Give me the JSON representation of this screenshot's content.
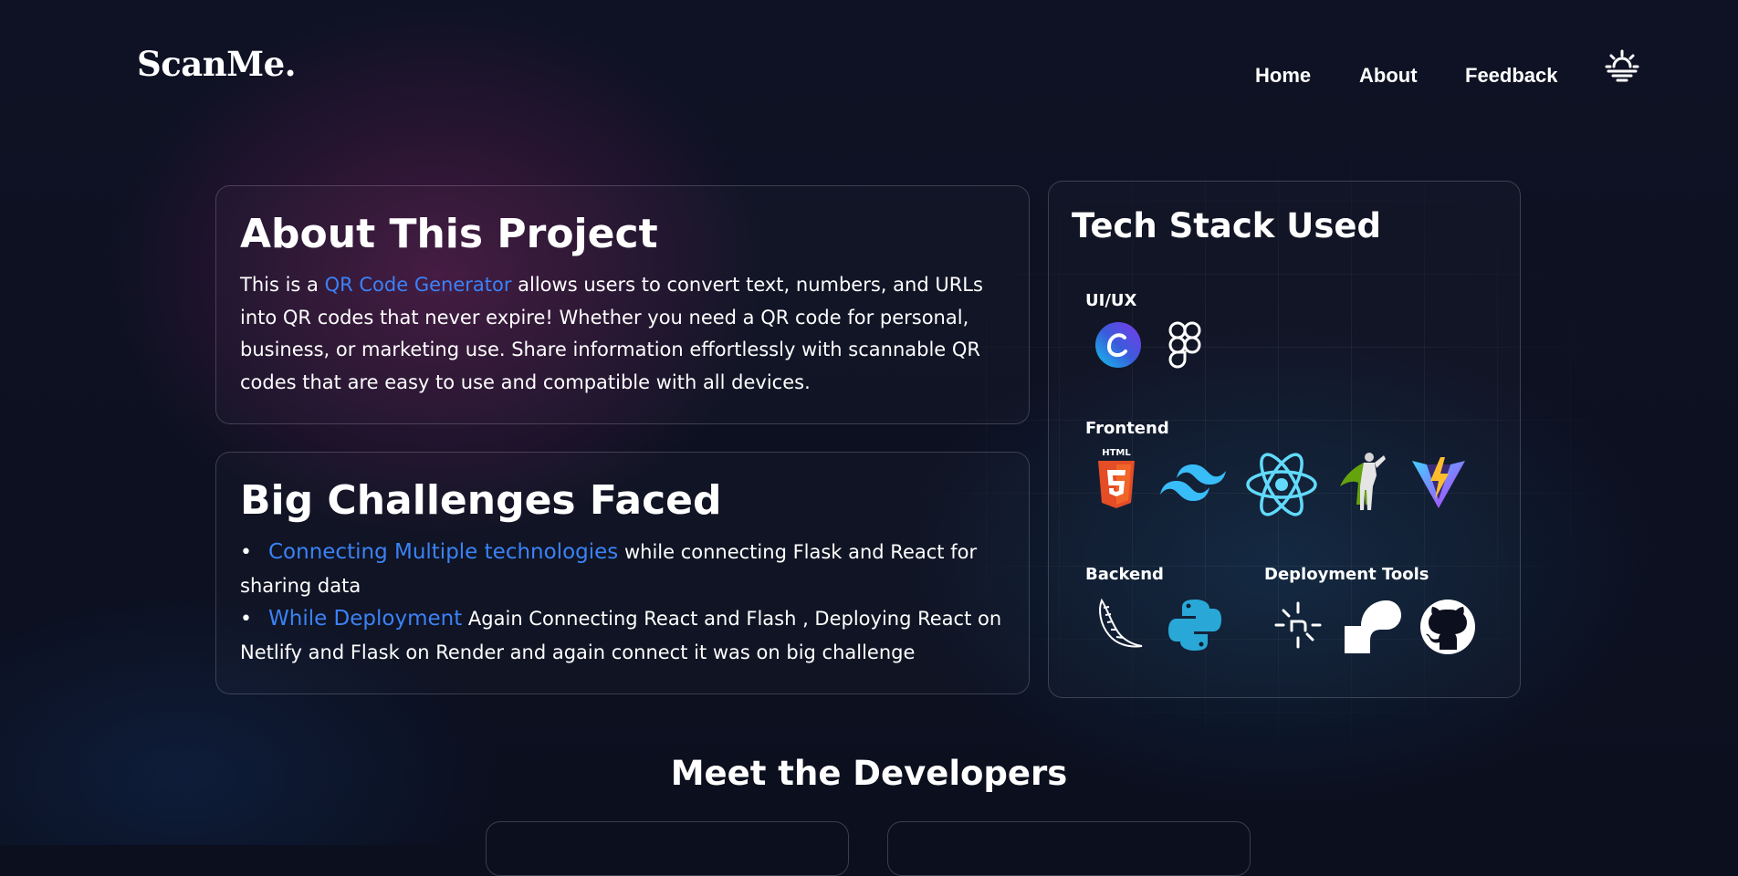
{
  "brand": {
    "logo": "ScanMe."
  },
  "nav": {
    "items": [
      "Home",
      "About",
      "Feedback"
    ],
    "theme_icon": "sun-horizon-icon"
  },
  "about": {
    "title": "About This Project",
    "text_before": "This is a ",
    "link": "QR Code Generator",
    "text_after": " allows users to convert text, numbers, and URLs into QR codes that never expire! Whether you need a QR code for personal, business, or marketing use. Share information effortlessly with scannable QR codes that are easy to use and compatible with all devices."
  },
  "challenges": {
    "title": "Big Challenges Faced",
    "items": [
      {
        "highlight": "Connecting Multiple technologies",
        "text": " while connecting Flask and React for sharing data"
      },
      {
        "highlight": "While Deployment",
        "text": " Again Connecting React and Flash , Deploying React on Netlify and Flask on Render and again connect it was on big challenge"
      }
    ]
  },
  "tech_stack": {
    "title": "Tech Stack Used",
    "sections": {
      "uiux": {
        "label": "UI/UX",
        "icons": [
          "canva-icon",
          "figma-icon"
        ]
      },
      "frontend": {
        "label": "Frontend",
        "icons": [
          "html5-icon",
          "tailwind-icon",
          "react-icon",
          "superhero-icon",
          "vite-icon"
        ],
        "html_caption": "HTML"
      },
      "backend": {
        "label": "Backend",
        "icons": [
          "flask-icon",
          "python-icon"
        ]
      },
      "deployment": {
        "label": "Deployment Tools",
        "icons": [
          "netlify-icon",
          "render-icon",
          "github-icon"
        ]
      }
    }
  },
  "developers": {
    "title": "Meet the Developers"
  },
  "colors": {
    "background": "#0b0f1e",
    "accent": "#3b82f6",
    "text": "#ffffff"
  }
}
